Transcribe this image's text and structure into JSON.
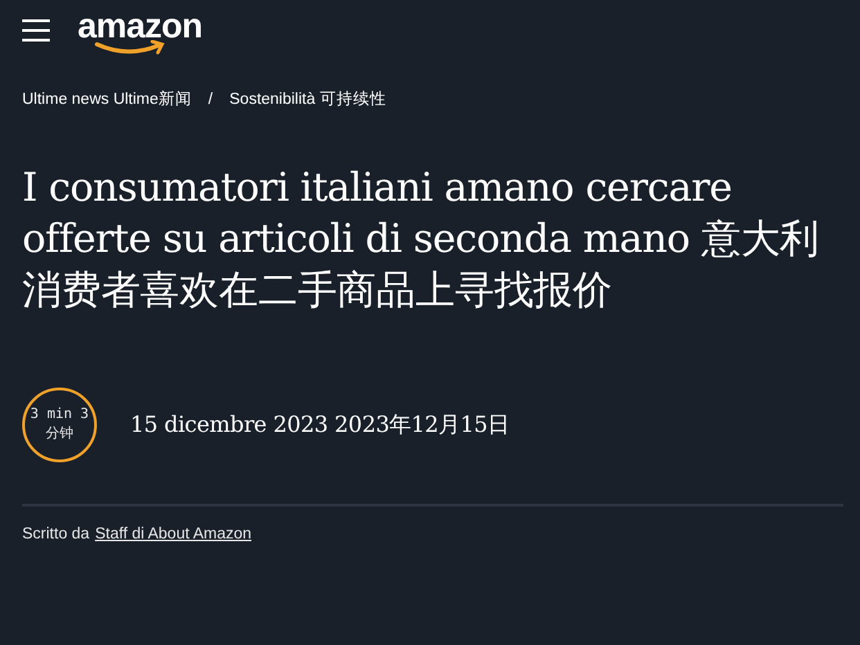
{
  "header": {
    "logo": "amazon"
  },
  "breadcrumb": [
    {
      "label": "Ultime news Ultime新闻"
    },
    {
      "label": "Sostenibilità 可持续性"
    }
  ],
  "breadcrumb_separator": "/",
  "title": "I consumatori italiani amano cercare offerte su articoli di seconda mano 意大利消费者喜欢在二手商品上寻找报价",
  "read_time": {
    "line_1": "3 min 3",
    "line_2": "分钟"
  },
  "date": "15 dicembre 2023 2023年12月15日",
  "byline": {
    "prefix": "Scritto da",
    "author": "Staff di About Amazon"
  }
}
